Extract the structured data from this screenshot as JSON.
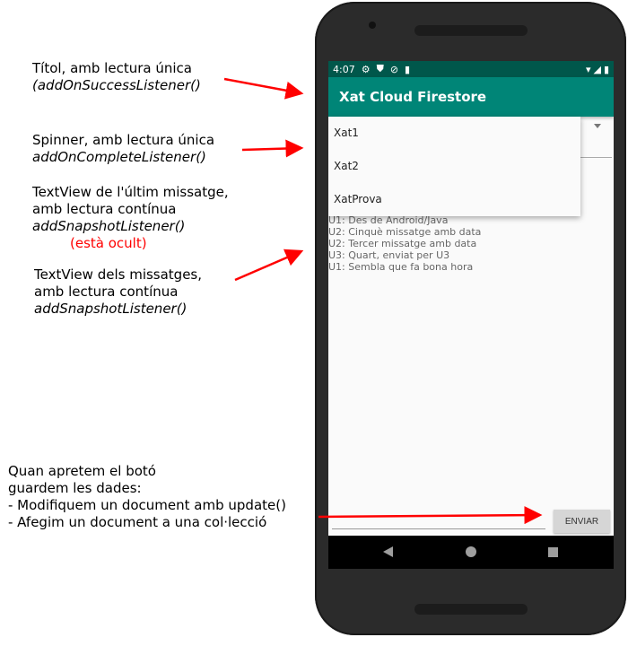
{
  "annotations": {
    "title": {
      "line1": "Títol, amb lectura única",
      "line2": "(addOnSuccessListener()"
    },
    "spinner": {
      "line1": "Spinner,  amb lectura única",
      "line2": "addOnCompleteListener()"
    },
    "last_message": {
      "line1": "TextView de l'últim missatge,",
      "line2": "amb lectura contínua",
      "line3": "addSnapshotListener()",
      "line4": "(està ocult)"
    },
    "messages": {
      "line1": "TextView dels missatges,",
      "line2": "amb lectura contínua",
      "line3": "addSnapshotListener()"
    },
    "button": {
      "line1": "Quan apretem el botó",
      "line2": "guardem les dades:",
      "line3": "- Modifiquem un document amb update()",
      "line4": "- Afegim un document a una col·lecció"
    }
  },
  "phone": {
    "status": {
      "time": "4:07"
    },
    "app_title": "Xat Cloud Firestore",
    "spinner_options": [
      "Xat1",
      "Xat2",
      "XatProva"
    ],
    "messages": [
      "U1: Des de Android/Java",
      "U2: Cinquè missatge amb data",
      "U2: Tercer missatge amb data",
      "U3: Quart, enviat per U3",
      "U1: Sembla que fa bona hora"
    ],
    "send_label": "ENVIAR"
  },
  "colors": {
    "status_bar": "#00574b",
    "app_bar": "#008577",
    "arrow": "#ff0000"
  }
}
